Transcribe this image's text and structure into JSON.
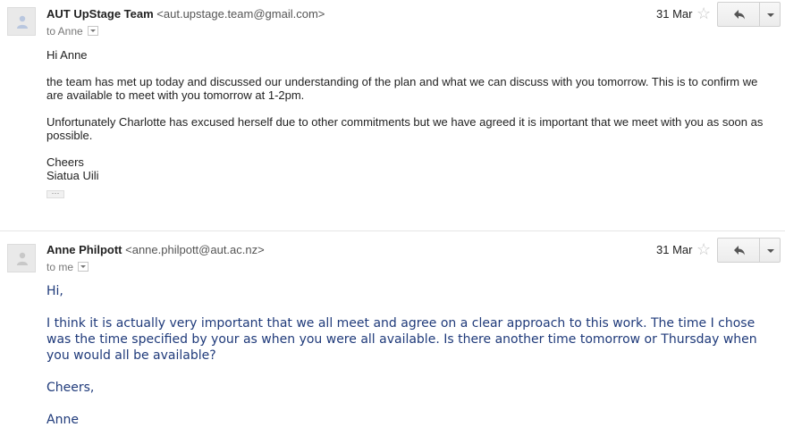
{
  "messages": [
    {
      "sender_name": "AUT UpStage Team",
      "sender_email": "<aut.upstage.team@gmail.com>",
      "to": "to Anne",
      "date": "31 Mar",
      "star_icon": "star-icon",
      "reply_icon": "reply-icon",
      "body": {
        "greeting": "Hi Anne",
        "para1": "the team has met up today and discussed our understanding of the plan and what we can discuss with you tomorrow. This is to confirm we are available to meet with you tomorrow at 1-2pm.",
        "para2": "Unfortunately Charlotte has excused herself due to other commitments but we have agreed it is important that we meet with you as soon as possible.",
        "signoff": "Cheers",
        "signature": "Siatua Uili"
      },
      "trimmed_content_label": "···"
    },
    {
      "sender_name": "Anne Philpott",
      "sender_email": "<anne.philpott@aut.ac.nz>",
      "to": "to me",
      "date": "31 Mar",
      "star_icon": "star-icon",
      "reply_icon": "reply-icon",
      "body": {
        "greeting": "Hi,",
        "para1": "I think it is actually very important that we all meet and agree on a clear approach to this work. The time I chose was the time specified by your as when you were all available. Is there another time tomorrow or Thursday when you would all be available?",
        "signoff": "Cheers,",
        "signature": "Anne"
      }
    }
  ],
  "colors": {
    "reply_text_blue": "#1f3a7a",
    "divider": "#e5e5e5",
    "star": "#c5c5c5"
  }
}
